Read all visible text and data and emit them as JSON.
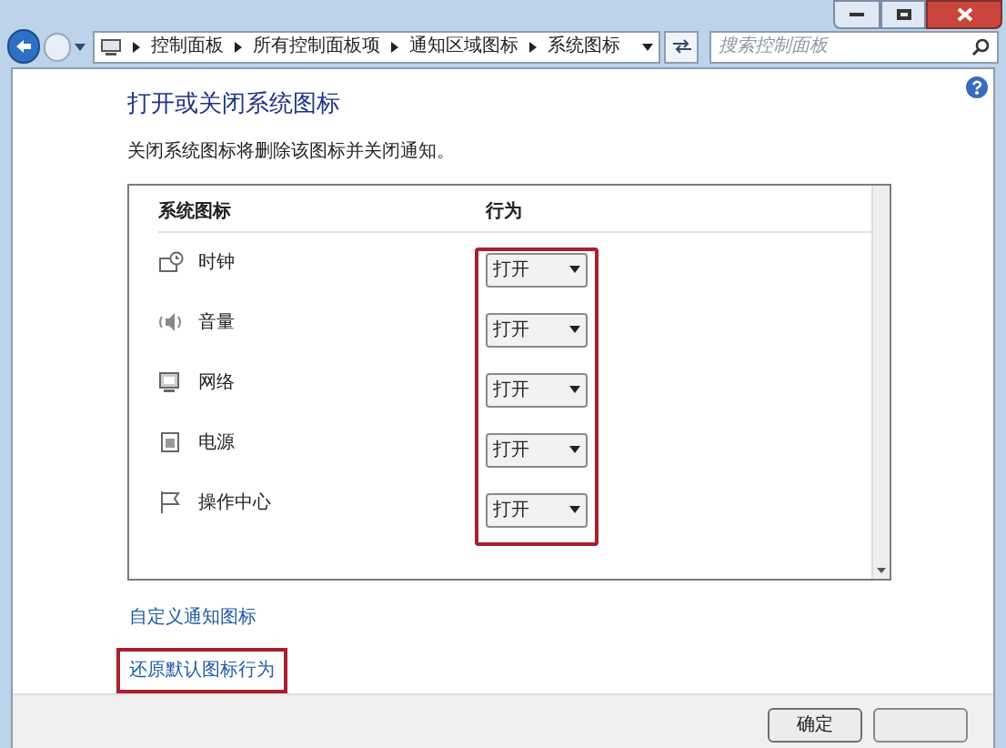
{
  "address_bar": {
    "crumbs": [
      "控制面板",
      "所有控制面板项",
      "通知区域图标",
      "系统图标"
    ],
    "search_placeholder": "搜索控制面板"
  },
  "heading": "打开或关闭系统图标",
  "description": "关闭系统图标将删除该图标并关闭通知。",
  "table": {
    "columns": [
      "系统图标",
      "行为"
    ],
    "behavior_highlighted": true,
    "rows": [
      {
        "kind": "clock",
        "name": "时钟",
        "behavior": "打开"
      },
      {
        "kind": "volume",
        "name": "音量",
        "behavior": "打开"
      },
      {
        "kind": "network",
        "name": "网络",
        "behavior": "打开"
      },
      {
        "kind": "power",
        "name": "电源",
        "behavior": "打开"
      },
      {
        "kind": "flag",
        "name": "操作中心",
        "behavior": "打开"
      }
    ]
  },
  "links": [
    {
      "label": "自定义通知图标",
      "highlighted": false
    },
    {
      "label": "还原默认图标行为",
      "highlighted": true
    }
  ],
  "buttons": [
    {
      "label": "确定"
    }
  ]
}
